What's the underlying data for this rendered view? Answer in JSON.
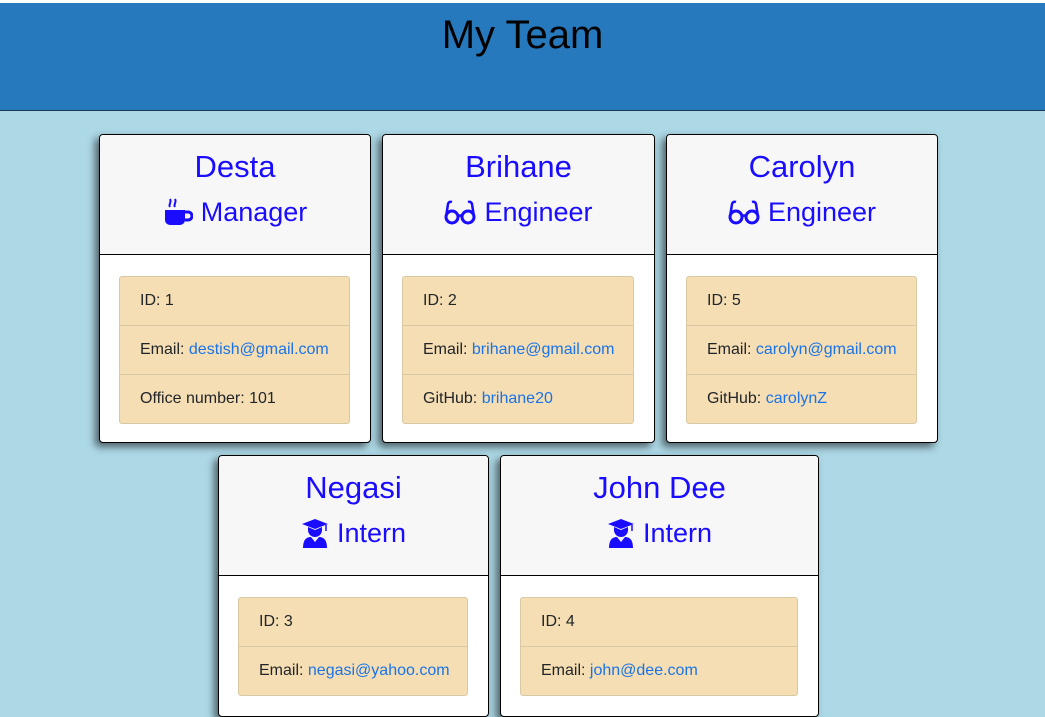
{
  "header": {
    "title": "My Team"
  },
  "icons": {
    "manager": "coffee-mug-icon",
    "engineer": "glasses-icon",
    "intern": "graduate-icon"
  },
  "colors": {
    "header_bg": "#2779bd",
    "page_bg": "#add8e6",
    "card_title": "#1a0dff",
    "info_bg": "#f5deb3",
    "link": "#1a73e8"
  },
  "employees": [
    {
      "name": "Desta",
      "role": "Manager",
      "id_label": "ID:",
      "id": "1",
      "email_label": "Email:",
      "email": "destish@gmail.com",
      "extra_label": "Office number:",
      "extra": "101"
    },
    {
      "name": "Brihane",
      "role": "Engineer",
      "id_label": "ID:",
      "id": "2",
      "email_label": "Email:",
      "email": "brihane@gmail.com",
      "extra_label": "GitHub:",
      "extra": "brihane20"
    },
    {
      "name": "Carolyn",
      "role": "Engineer",
      "id_label": "ID:",
      "id": "5",
      "email_label": "Email:",
      "email": "carolyn@gmail.com",
      "extra_label": "GitHub:",
      "extra": "carolynZ"
    },
    {
      "name": "Negasi",
      "role": "Intern",
      "id_label": "ID:",
      "id": "3",
      "email_label": "Email:",
      "email": "negasi@yahoo.com"
    },
    {
      "name": "John Dee",
      "role": "Intern",
      "id_label": "ID:",
      "id": "4",
      "email_label": "Email:",
      "email": "john@dee.com"
    }
  ]
}
